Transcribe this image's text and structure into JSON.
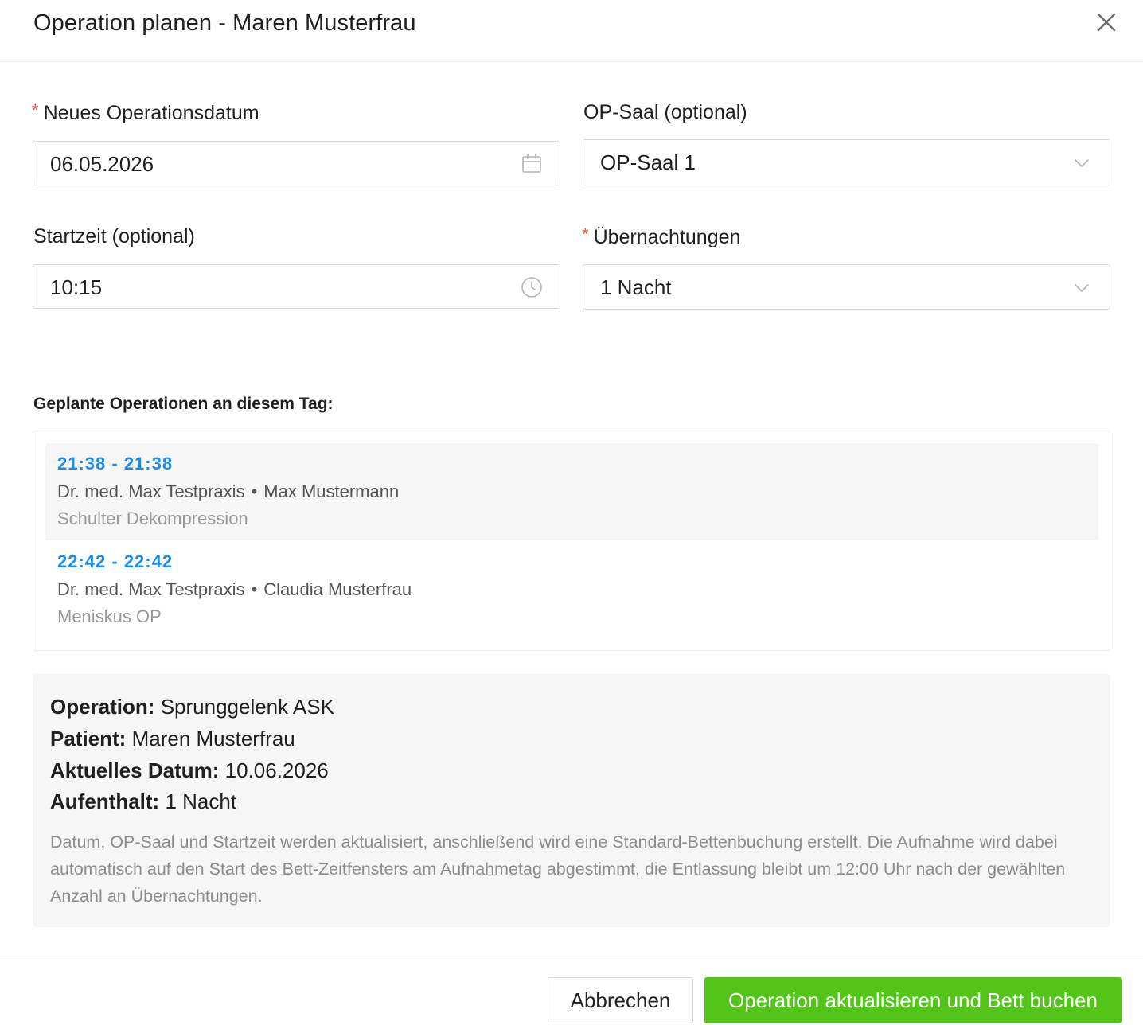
{
  "modal": {
    "title": "Operation planen - Maren Musterfrau"
  },
  "form": {
    "date": {
      "label": "Neues Operationsdatum",
      "required": true,
      "value": "06.05.2026"
    },
    "room": {
      "label": "OP-Saal (optional)",
      "required": false,
      "value": "OP-Saal 1"
    },
    "start_time": {
      "label": "Startzeit (optional)",
      "required": false,
      "value": "10:15"
    },
    "nights": {
      "label": "Übernachtungen",
      "required": true,
      "value": "1 Nacht"
    },
    "required_marker": "*"
  },
  "planned": {
    "heading": "Geplante Operationen an diesem Tag:",
    "separator": "•",
    "items": [
      {
        "time": "21:38 - 21:38",
        "doctor": "Dr. med. Max Testpraxis",
        "patient": "Max Mustermann",
        "procedure": "Schulter Dekompression"
      },
      {
        "time": "22:42 - 22:42",
        "doctor": "Dr. med. Max Testpraxis",
        "patient": "Claudia Musterfrau",
        "procedure": "Meniskus OP"
      }
    ]
  },
  "summary": {
    "operation_label": "Operation:",
    "operation_value": "Sprunggelenk ASK",
    "patient_label": "Patient:",
    "patient_value": "Maren Musterfrau",
    "current_date_label": "Aktuelles Datum:",
    "current_date_value": "10.06.2026",
    "stay_label": "Aufenthalt:",
    "stay_value": "1 Nacht",
    "note": "Datum, OP-Saal und Startzeit werden aktualisiert, anschließend wird eine Standard-Bettenbuchung erstellt. Die Aufnahme wird dabei automatisch auf den Start des Bett-Zeitfensters am Aufnahmetag abgestimmt, die Entlassung bleibt um 12:00 Uhr nach der gewählten Anzahl an Übernachtungen."
  },
  "footer": {
    "cancel_label": "Abbrechen",
    "submit_label": "Operation aktualisieren und Bett buchen"
  },
  "icons": {
    "close": "close-icon",
    "calendar": "calendar-icon",
    "clock": "clock-icon",
    "chevron": "chevron-down-icon"
  },
  "colors": {
    "primary_button": "#52c41a",
    "time_accent": "#1a8cf0",
    "required_marker": "#ff4d4f"
  }
}
